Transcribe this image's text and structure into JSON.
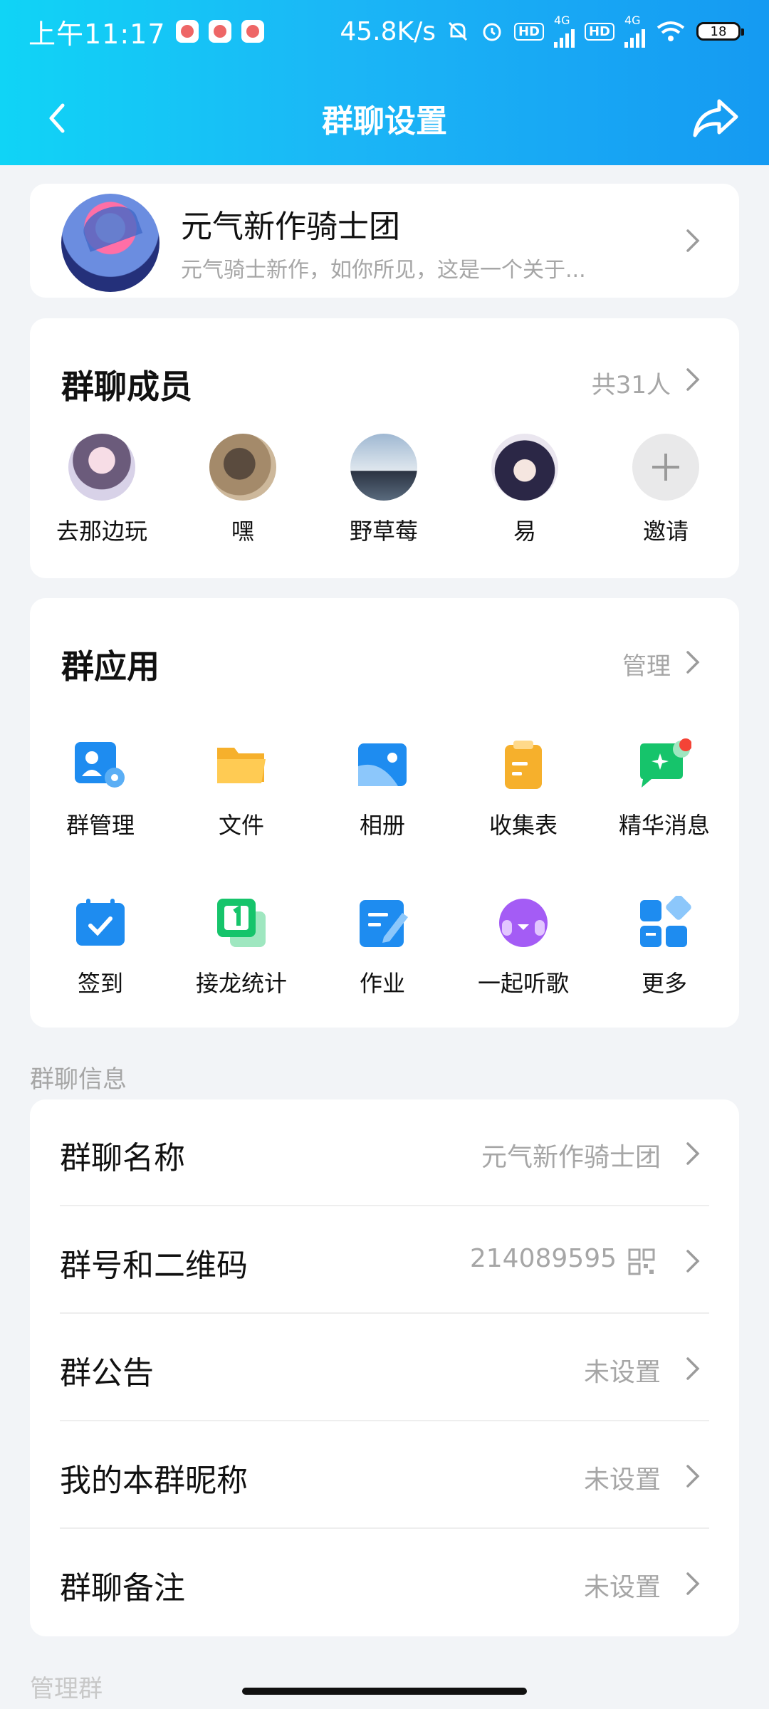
{
  "status_bar": {
    "time": "上午11:17",
    "net_speed": "45.8K/s",
    "battery": "18",
    "hd1": "HD",
    "hd2": "HD",
    "net1": "4G",
    "net2": "4G"
  },
  "header": {
    "title": "群聊设置",
    "back_icon": "back-arrow-icon",
    "share_icon": "share-icon"
  },
  "group": {
    "name": "元气新作骑士团",
    "description": "元气骑士新作，如你所见，这是一个关于..."
  },
  "members": {
    "title": "群聊成员",
    "count_text": "共31人",
    "items": [
      {
        "name": "去那边玩"
      },
      {
        "name": "嘿"
      },
      {
        "name": "野草莓"
      },
      {
        "name": "易"
      },
      {
        "name": "邀请"
      }
    ]
  },
  "apps": {
    "title": "群应用",
    "manage_text": "管理",
    "items": [
      {
        "label": "群管理",
        "icon": "group-manage-icon"
      },
      {
        "label": "文件",
        "icon": "folder-icon"
      },
      {
        "label": "相册",
        "icon": "album-icon"
      },
      {
        "label": "收集表",
        "icon": "clipboard-icon"
      },
      {
        "label": "精华消息",
        "icon": "essence-message-icon"
      },
      {
        "label": "签到",
        "icon": "calendar-check-icon"
      },
      {
        "label": "接龙统计",
        "icon": "relay-count-icon"
      },
      {
        "label": "作业",
        "icon": "homework-icon"
      },
      {
        "label": "一起听歌",
        "icon": "music-together-icon"
      },
      {
        "label": "更多",
        "icon": "more-grid-icon"
      }
    ]
  },
  "info": {
    "section_label": "群聊信息",
    "rows": [
      {
        "key": "群聊名称",
        "value": "元气新作骑士团"
      },
      {
        "key": "群号和二维码",
        "value": "214089595"
      },
      {
        "key": "群公告",
        "value": "未设置"
      },
      {
        "key": "我的本群昵称",
        "value": "未设置"
      },
      {
        "key": "群聊备注",
        "value": "未设置"
      }
    ]
  },
  "next_section_label": "管理群",
  "colors": {
    "header_start": "#10d4f6",
    "header_end": "#159af2",
    "background": "#f2f4f7",
    "muted_text": "#a6a6a6",
    "badge_red": "#f44336"
  }
}
